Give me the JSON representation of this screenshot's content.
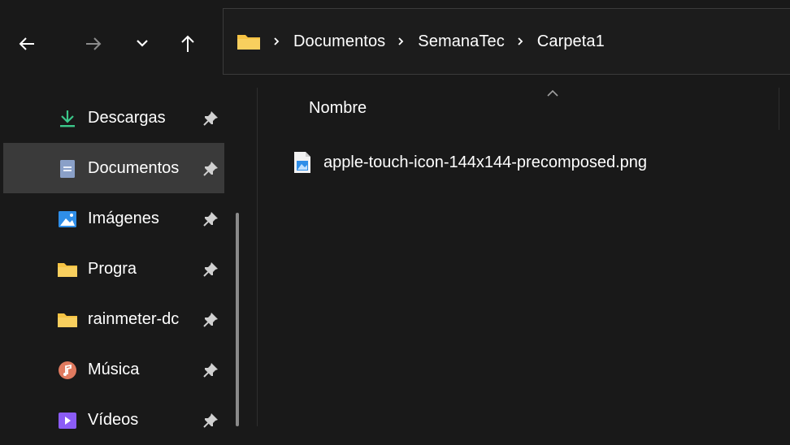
{
  "toolbar": {
    "back_icon": "arrow-left-icon",
    "forward_icon": "arrow-right-icon",
    "recent_icon": "chevron-down-icon",
    "up_icon": "arrow-up-icon"
  },
  "address": {
    "root_icon": "folder-icon",
    "crumbs": [
      "Documentos",
      "SemanaTec",
      "Carpeta1"
    ]
  },
  "sidebar": {
    "items": [
      {
        "label": "Descargas",
        "icon": "download-icon",
        "pinned": true
      },
      {
        "label": "Documentos",
        "icon": "document-icon",
        "pinned": true,
        "selected": true
      },
      {
        "label": "Imágenes",
        "icon": "picture-icon",
        "pinned": true
      },
      {
        "label": "Progra",
        "icon": "folder-icon",
        "pinned": true
      },
      {
        "label": "rainmeter-dc",
        "icon": "folder-icon",
        "pinned": true
      },
      {
        "label": "Música",
        "icon": "music-icon",
        "pinned": true
      },
      {
        "label": "Vídeos",
        "icon": "video-icon",
        "pinned": true
      }
    ]
  },
  "content": {
    "columns": [
      {
        "label": "Nombre",
        "sort": "ascending"
      }
    ],
    "files": [
      {
        "name": "apple-touch-icon-144x144-precomposed.png",
        "icon": "image-file-icon"
      }
    ]
  },
  "colors": {
    "background": "#191919",
    "selected": "#3a3a3a",
    "folder": "#f6c343",
    "download": "#3bc88a",
    "document": "#8aa0c8",
    "picture": "#2f8ee8",
    "music": "#e07a5f",
    "video": "#8b5cf6"
  }
}
